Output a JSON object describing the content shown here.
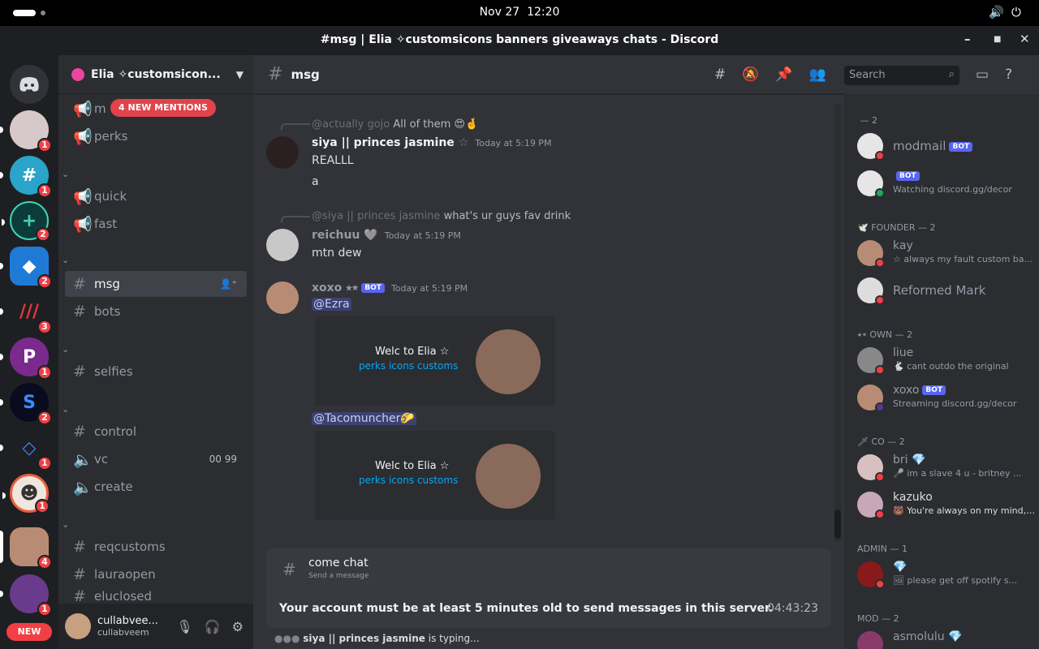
{
  "system": {
    "date": "Nov 27",
    "time": "12:20"
  },
  "window": {
    "title": "#﻿msg | Elia ✧﻿customs﻿icons ﻿banners ﻿giveaways ﻿chats - Discord"
  },
  "servers": {
    "badges": [
      "1",
      "1",
      "2",
      "2",
      "3",
      "1",
      "2",
      "1",
      "1",
      "4",
      "1"
    ],
    "new_label": "NEW"
  },
  "guild": {
    "name": "Elia ✧﻿customs﻿icon..."
  },
  "mentions_label": "4 NEW MENTIONS",
  "channels": [
    {
      "name": "﻿m",
      "icon": "announcement-icon"
    },
    {
      "name": "﻿perks",
      "icon": "announcement-icon"
    },
    {
      "name": "﻿quick",
      "icon": "announcement-icon"
    },
    {
      "name": "﻿fast",
      "icon": "announcement-icon"
    },
    {
      "name": "﻿msg",
      "icon": "hash-icon"
    },
    {
      "name": "﻿bots",
      "icon": "hash-icon"
    },
    {
      "name": "﻿selfies",
      "icon": "hash-icon"
    },
    {
      "name": "﻿control",
      "icon": "hash-icon"
    },
    {
      "name": "﻿vc",
      "icon": "speaker-icon",
      "extra": "00  99"
    },
    {
      "name": "﻿create",
      "icon": "speaker-icon"
    },
    {
      "name": "﻿req﻿customs",
      "icon": "hash-icon"
    },
    {
      "name": "﻿laura﻿open",
      "icon": "hash-icon"
    },
    {
      "name": "﻿elu﻿closed",
      "icon": "hash-icon"
    }
  ],
  "categories": [
    "﻿",
    "﻿",
    "﻿",
    "﻿",
    "﻿"
  ],
  "user": {
    "display": "cullabvee...",
    "username": "cullabveem"
  },
  "channel_header": {
    "name": "﻿msg",
    "search_placeholder": "Search"
  },
  "messages": [
    {
      "reply_name": "@actually gojo",
      "reply_text": "All of them 😍🤞",
      "author": "siya || princes jasmine",
      "author_suffix": "☆",
      "time": "Today at 5:19 PM",
      "lines": [
        "REALLL",
        "a"
      ]
    },
    {
      "reply_name": "@siya || princes jasmine",
      "reply_text": "what's ur guys fav drink",
      "author": "reichuu",
      "author_suffix": "🩶",
      "time": "Today at 5:19 PM",
      "lines": [
        "mtn dew"
      ]
    },
    {
      "author": "xoxo",
      "author_suffix": "⭑⭒",
      "bot": "BOT",
      "time": "Today at 5:19 PM",
      "mention1": "@Ezra",
      "mention2": "@Tacomuncher🌮",
      "embed_title": "Welc to Elia ☆",
      "embed_link": "perks icons customs"
    }
  ],
  "composer": {
    "title": "come chat",
    "subtitle": "Send a message",
    "warning": "Your account must be at least 5 minutes old to send messages in this server.",
    "countdown": "04:43:23"
  },
  "typing": {
    "who": "siya || princes jasmine",
    "rest": " is typing..."
  },
  "member_groups": [
    {
      "label": "﻿ — 2",
      "members": [
        {
          "name": "modmail",
          "bot": "BOT",
          "status_text": ""
        },
        {
          "name": "﻿",
          "bot": "BOT",
          "status_text": "Watching discord.gg/decor"
        }
      ]
    },
    {
      "label": "🕊️ FOUNDER — 2",
      "members": [
        {
          "name": "kay",
          "status_text": "☆ always my fault custom ba..."
        },
        {
          "name": "Reformed Mark",
          "status_text": ""
        }
      ]
    },
    {
      "label": "⭑⭒ ﻿OWN — 2",
      "members": [
        {
          "name": "liue",
          "status_text": "🐇 cant outdo the original"
        },
        {
          "name": "xoxo",
          "bot": "BOT",
          "status_text": "Streaming discord.gg/decor"
        }
      ]
    },
    {
      "label": "🗡 ﻿CO — 2",
      "members": [
        {
          "name": "bri 💎",
          "status_text": "🎤 im a slave 4 u - britney ..."
        },
        {
          "name": "kazuko",
          "status_text": "🐻 You're always on my mind, ..."
        }
      ]
    },
    {
      "label": "﻿ADMIN — 1",
      "members": [
        {
          "name": "💎",
          "status_text": "🖼 please get off spotify s..."
        }
      ]
    },
    {
      "label": "﻿MOD — 2",
      "members": [
        {
          "name": "asmolulu 💎",
          "status_text": ""
        }
      ]
    }
  ],
  "colors": {
    "accent": "#5865f2",
    "danger": "#f23f43",
    "online": "#23a559",
    "link": "#00a8fc"
  }
}
